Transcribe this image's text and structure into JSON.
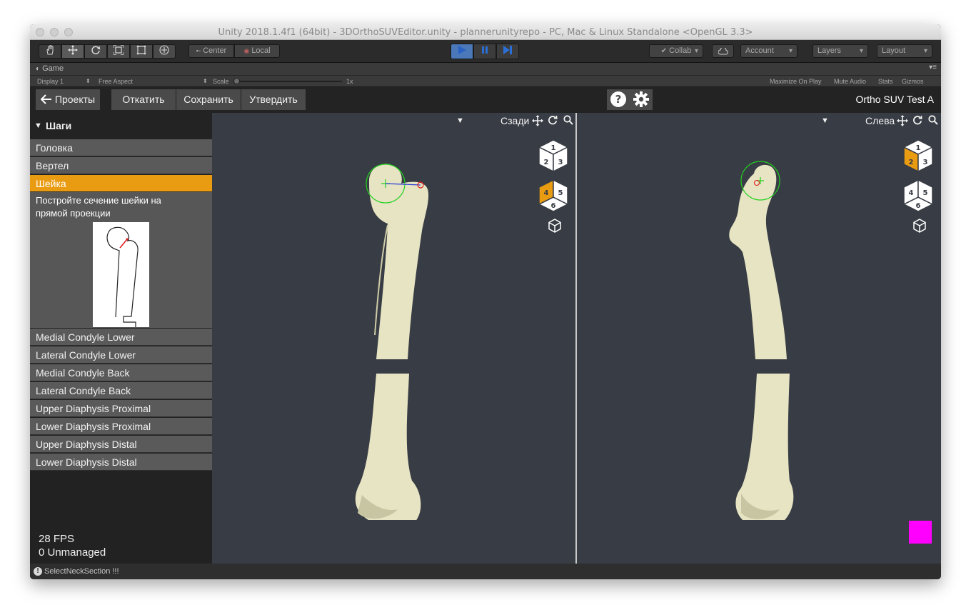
{
  "window": {
    "title": "Unity 2018.1.4f1 (64bit) - 3DOrthoSUVEditor.unity - plannerunityrepo - PC, Mac & Linux Standalone <OpenGL 3.3>"
  },
  "toolbar": {
    "tools": [
      "hand-icon",
      "move-icon",
      "rotate-icon",
      "scale-icon",
      "rect-icon",
      "transform-icon"
    ],
    "pivot_label": "Center",
    "space_label": "Local",
    "play_icon": "play-icon",
    "pause_icon": "pause-icon",
    "step_icon": "step-icon",
    "collab_label": "Collab",
    "cloud_icon": "cloud-icon",
    "account_label": "Account",
    "layers_label": "Layers",
    "layout_label": "Layout",
    "accent_color": "#2b6fd6"
  },
  "game_tab": {
    "label": "Game",
    "display": "Display 1",
    "aspect": "Free Aspect",
    "scale_label": "Scale",
    "scale_value": "1x",
    "maximize_label": "Maximize On Play",
    "mute_label": "Mute Audio",
    "stats_label": "Stats",
    "gizmos_label": "Gizmos"
  },
  "app": {
    "back_label": "Проекты",
    "rollback_label": "Откатить",
    "save_label": "Сохранить",
    "confirm_label": "Утвердить",
    "project_name": "Ortho SUV Test A",
    "help_icon": "help-icon",
    "settings_icon": "gear-icon"
  },
  "sidebar": {
    "header": "Шаги",
    "steps_top": [
      "Головка",
      "Вертел"
    ],
    "active_step": "Шейка",
    "active_description": "Постройте сечение шейки на прямой проекции",
    "steps_bottom": [
      "Medial Condyle Lower",
      "Lateral Condyle Lower",
      "Medial Condyle Back",
      "Lateral Condyle Back",
      "Upper Diaphysis Proximal",
      "Lower Diaphysis Proximal",
      "Upper Diaphysis Distal",
      "Lower Diaphysis Distal"
    ],
    "active_color": "#e99b12",
    "fps": "28 FPS",
    "unmanaged": "0 Unmanaged"
  },
  "viewports": {
    "left_label": "Сзади",
    "right_label": "Слева",
    "cube_faces_a": [
      "1",
      "2",
      "3"
    ],
    "cube_faces_b": [
      "4",
      "5",
      "6"
    ],
    "marker_color": "#ff00ff"
  },
  "status": {
    "message": "SelectNeckSection !!!"
  }
}
